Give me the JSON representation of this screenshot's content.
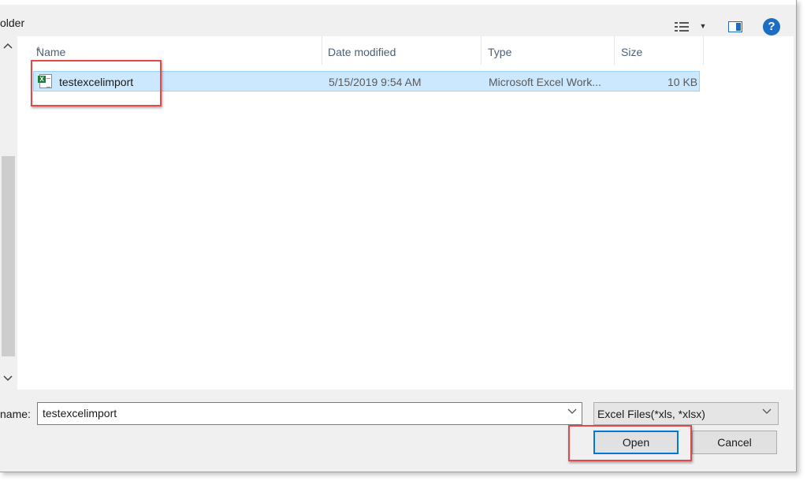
{
  "toolbar": {
    "new_folder_label": "older",
    "view_icon": "details-view-icon",
    "dropdown_icon": "chevron-down-icon",
    "preview_icon": "preview-pane-icon",
    "help_label": "?"
  },
  "file_list": {
    "columns": [
      "Name",
      "Date modified",
      "Type",
      "Size"
    ],
    "rows": [
      {
        "name": "testexcelimport",
        "date_modified": "5/15/2019 9:54 AM",
        "type": "Microsoft Excel Work...",
        "size": "10 KB",
        "icon": "excel-file-icon"
      }
    ]
  },
  "scrollbar": {
    "up_glyph": "^",
    "down_glyph": "v"
  },
  "footer": {
    "file_name_label": "name:",
    "file_name_value": "testexcelimport",
    "filter_value": "Excel Files(*xls, *xlsx)",
    "open_label": "Open",
    "cancel_label": "Cancel"
  },
  "colors": {
    "selection_bg": "#cce8ff",
    "selection_border": "#99d1ff",
    "highlight_box": "#e24a4a",
    "accent": "#0078d7"
  }
}
